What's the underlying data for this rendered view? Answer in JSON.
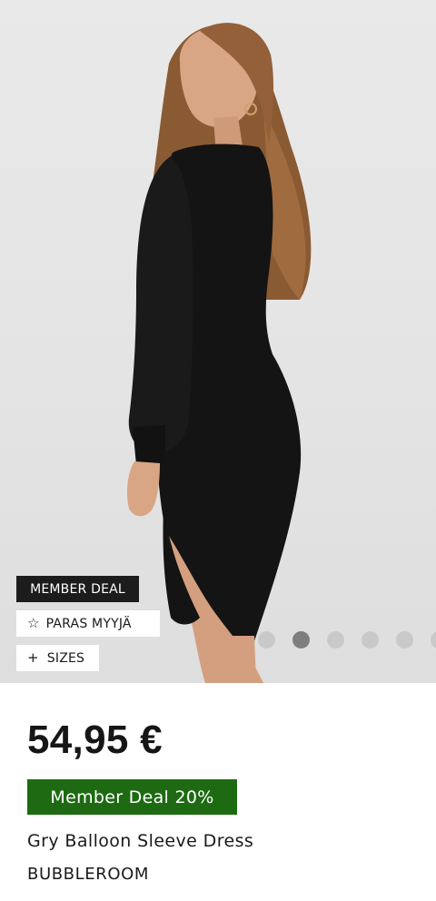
{
  "product_image": {
    "alt": "Gry Balloon Sleeve Dress",
    "colors": {
      "background": "#e6e6e6",
      "dress": "#141414",
      "hair": "#8a5a33",
      "skin": "#d9a685"
    }
  },
  "badges": {
    "member_deal": "MEMBER DEAL",
    "bestseller_icon": "star-outline-icon",
    "bestseller": "PARAS MYYJÄ",
    "sizes_icon": "plus-icon",
    "sizes": "SIZES"
  },
  "carousel": {
    "total": 6,
    "active_index": 1
  },
  "product": {
    "price": "54,95 €",
    "deal_tag": "Member Deal 20%",
    "name": "Gry Balloon Sleeve Dress",
    "brand": "BUBBLEROOM"
  },
  "colors": {
    "deal_green": "#1e6a13",
    "badge_dark": "#1c1c1c"
  }
}
